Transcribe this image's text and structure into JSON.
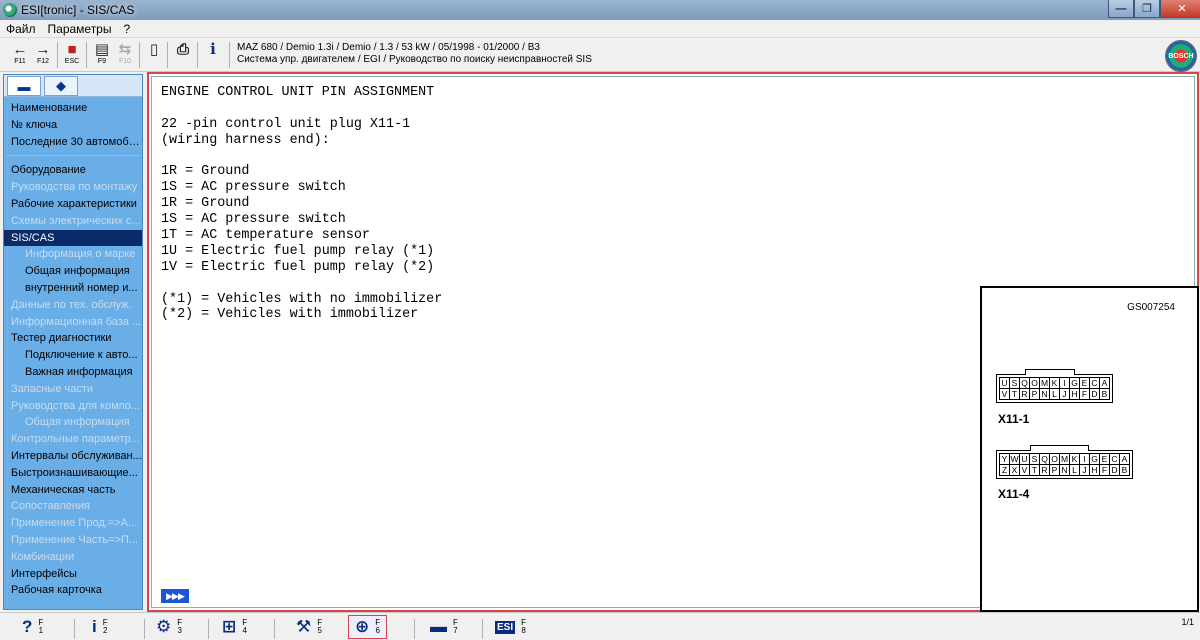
{
  "window": {
    "title": "ESI[tronic] - SIS/CAS"
  },
  "menu": [
    "Файл",
    "Параметры",
    "?"
  ],
  "toolbar": {
    "buttons": [
      {
        "icon": "back-arrow-icon",
        "glyph": "←",
        "key": "F11"
      },
      {
        "icon": "forward-arrow-icon",
        "glyph": "→",
        "key": "F12"
      },
      {
        "icon": "esc-stop-icon",
        "glyph": "■",
        "key": "ESC"
      },
      {
        "icon": "document-list-icon",
        "glyph": "▤",
        "key": "F9"
      },
      {
        "icon": "compare-icon",
        "glyph": "⇆",
        "key": "F10"
      },
      {
        "icon": "page-icon",
        "glyph": "▯",
        "key": ""
      },
      {
        "icon": "printer-icon",
        "glyph": "⎙",
        "key": ""
      },
      {
        "icon": "info-icon",
        "glyph": "i",
        "key": ""
      }
    ],
    "vehicle_line1": "MAZ 680 / Demio 1.3i / Demio / 1.3 / 53 kW / 05/1998 - 01/2000 / B3",
    "vehicle_line2": "Система упр. двигателем / EGI  / Руководство по поиску неисправностей SIS",
    "logo": "BOSCH"
  },
  "sidebar": {
    "tabs": [
      "car-icon",
      "engine-icon"
    ],
    "groups": [
      [
        {
          "label": "Наименование",
          "state": "normal",
          "sub": false
        },
        {
          "label": "№ ключа",
          "state": "normal",
          "sub": false
        },
        {
          "label": "Последние 30 автомоби...",
          "state": "normal",
          "sub": false
        }
      ],
      [
        {
          "label": "Оборудование",
          "state": "normal",
          "sub": false
        },
        {
          "label": "Руководства по монтажу",
          "state": "disabled",
          "sub": false
        },
        {
          "label": "Рабочие характеристики",
          "state": "normal",
          "sub": false
        },
        {
          "label": "Схемы электрических с...",
          "state": "disabled",
          "sub": false
        },
        {
          "label": "SIS/CAS",
          "state": "selected",
          "sub": false
        },
        {
          "label": "Информация о марке",
          "state": "disabled",
          "sub": true
        },
        {
          "label": "Общая информация",
          "state": "normal",
          "sub": true
        },
        {
          "label": "внутренний номер и...",
          "state": "normal",
          "sub": true
        },
        {
          "label": "Данные по тех. обслуж.",
          "state": "disabled",
          "sub": false
        },
        {
          "label": "Информационная база ...",
          "state": "disabled",
          "sub": false
        },
        {
          "label": "Тестер диагностики",
          "state": "normal",
          "sub": false
        },
        {
          "label": "Подключение к авто...",
          "state": "normal",
          "sub": true
        },
        {
          "label": "Важная информация",
          "state": "normal",
          "sub": true
        },
        {
          "label": "Запасные части",
          "state": "disabled",
          "sub": false
        },
        {
          "label": "Руководства для компо...",
          "state": "disabled",
          "sub": false
        },
        {
          "label": "Общая информация",
          "state": "disabled",
          "sub": true
        },
        {
          "label": "Контрольные параметр...",
          "state": "disabled",
          "sub": false
        },
        {
          "label": "Интервалы обслуживан...",
          "state": "normal",
          "sub": false
        },
        {
          "label": "Быстроизнашивающие...",
          "state": "normal",
          "sub": false
        },
        {
          "label": "Механическая часть",
          "state": "normal",
          "sub": false
        },
        {
          "label": "Сопоставления",
          "state": "disabled",
          "sub": false
        },
        {
          "label": "Применение Прод.=>А...",
          "state": "disabled",
          "sub": false
        },
        {
          "label": "Применение Часть=>П...",
          "state": "disabled",
          "sub": false
        },
        {
          "label": "Комбинации",
          "state": "disabled",
          "sub": false
        },
        {
          "label": "Интерфейсы",
          "state": "normal",
          "sub": false
        },
        {
          "label": "Рабочая карточка",
          "state": "normal",
          "sub": false
        }
      ]
    ]
  },
  "document": {
    "lines": [
      "ENGINE CONTROL UNIT PIN ASSIGNMENT",
      "",
      "22 -pin control unit plug X11-1",
      "(wiring harness end):",
      "",
      "1R = Ground",
      "1S = AC pressure switch",
      "1R = Ground",
      "1S = AC pressure switch",
      "1T = AC temperature sensor",
      "1U = Electric fuel pump relay (*1)",
      "1V = Electric fuel pump relay (*2)",
      "",
      "(*1) = Vehicles with no immobilizer",
      "(*2) = Vehicles with immobilizer"
    ],
    "more_button": "▶▶▶"
  },
  "diagram": {
    "id": "GS007254",
    "connectors": [
      {
        "label": "X11-1",
        "rows": [
          [
            "U",
            "S",
            "Q",
            "O",
            "M",
            "K",
            "I",
            "G",
            "E",
            "C",
            "A"
          ],
          [
            "V",
            "T",
            "R",
            "P",
            "N",
            "L",
            "J",
            "H",
            "F",
            "D",
            "B"
          ]
        ]
      },
      {
        "label": "X11-4",
        "rows": [
          [
            "Y",
            "W",
            "U",
            "S",
            "Q",
            "O",
            "M",
            "K",
            "I",
            "G",
            "E",
            "C",
            "A"
          ],
          [
            "Z",
            "X",
            "V",
            "T",
            "R",
            "P",
            "N",
            "L",
            "J",
            "H",
            "F",
            "D",
            "B"
          ]
        ]
      }
    ]
  },
  "bottombar": {
    "buttons": [
      {
        "icon": "help-icon",
        "glyph": "?",
        "key": "F\n1"
      },
      {
        "icon": "info-icon",
        "glyph": "i",
        "key": "F\n2"
      },
      {
        "icon": "wiring-diagram-icon",
        "glyph": "⚙",
        "key": "F\n3"
      },
      {
        "icon": "component-diagram-icon",
        "glyph": "⊞",
        "key": "F\n4"
      },
      {
        "icon": "tools-icon",
        "glyph": "⚒",
        "key": "F\n5"
      },
      {
        "icon": "zoom-icon",
        "glyph": "⊕",
        "key": "F\n6"
      },
      {
        "icon": "vehicle-icon",
        "glyph": "▬",
        "key": "F\n7"
      },
      {
        "icon": "esi-kts-icon",
        "glyph": "ESI",
        "key": "F\n8"
      }
    ],
    "active_index": 5,
    "pager": "1/1"
  }
}
